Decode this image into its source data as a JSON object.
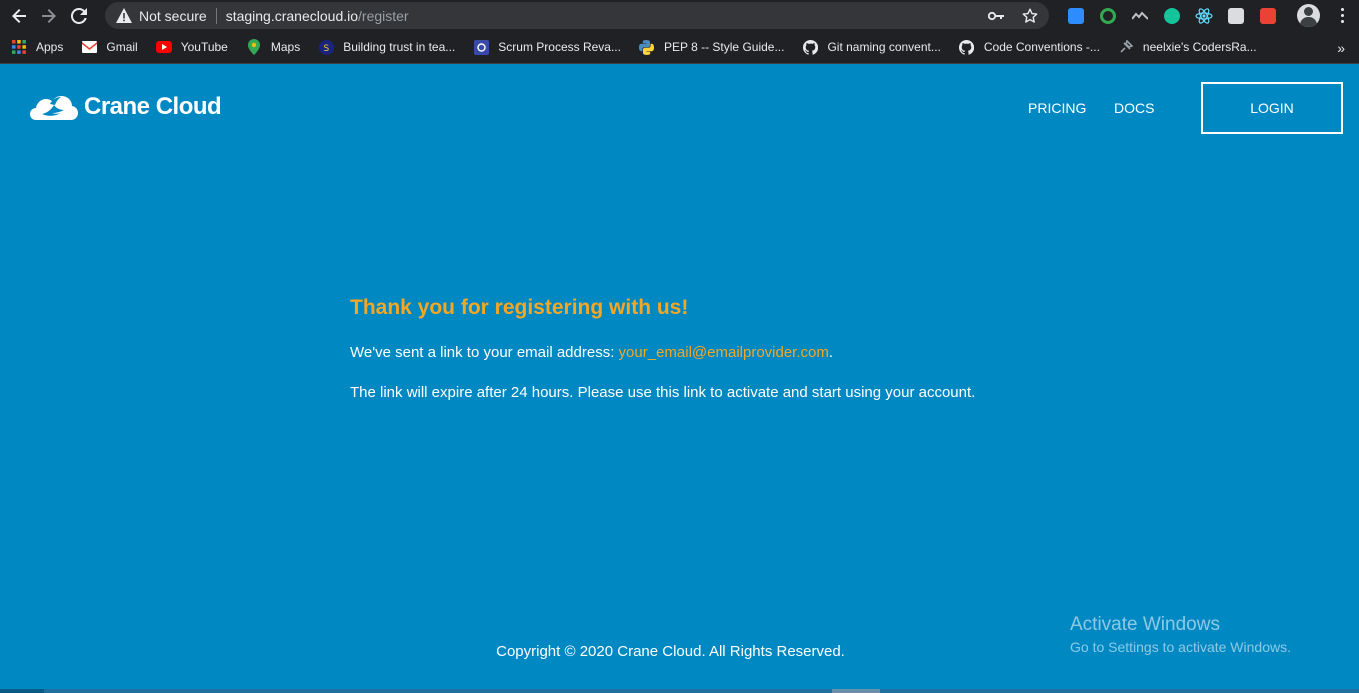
{
  "browser": {
    "security_label": "Not secure",
    "url_host": "staging.cranecloud.io",
    "url_path": "/register",
    "bookmarks": [
      {
        "label": "Apps",
        "icon": "apps-grid-icon"
      },
      {
        "label": "Gmail",
        "icon": "gmail-icon"
      },
      {
        "label": "YouTube",
        "icon": "youtube-icon"
      },
      {
        "label": "Maps",
        "icon": "maps-pin-icon"
      },
      {
        "label": "Building trust in tea...",
        "icon": "page-icon"
      },
      {
        "label": "Scrum Process Reva...",
        "icon": "scrum-icon"
      },
      {
        "label": "PEP 8 -- Style Guide...",
        "icon": "python-icon"
      },
      {
        "label": "Git naming convent...",
        "icon": "github-icon"
      },
      {
        "label": "Code Conventions -...",
        "icon": "github-icon"
      },
      {
        "label": "neelxie's CodersRa...",
        "icon": "bookmark-pin-icon"
      }
    ],
    "more_label": "»"
  },
  "site": {
    "brand": "Crane Cloud",
    "nav": {
      "pricing": "PRICING",
      "docs": "DOCS",
      "login": "LOGIN"
    }
  },
  "content": {
    "title": "Thank you for registering with us!",
    "sent_prefix": "We've sent a link to your email address: ",
    "email": "your_email@emailprovider.com",
    "sent_suffix": ".",
    "expiry": "The link will expire after 24 hours. Please use this link to activate and start using your account."
  },
  "footer": {
    "copyright": "Copyright © 2020 Crane Cloud. All Rights Reserved."
  },
  "watermark": {
    "line1": "Activate Windows",
    "line2": "Go to Settings to activate Windows."
  },
  "colors": {
    "page_bg": "#0088c3",
    "accent": "#f5a623",
    "chrome_bg": "#202124"
  }
}
